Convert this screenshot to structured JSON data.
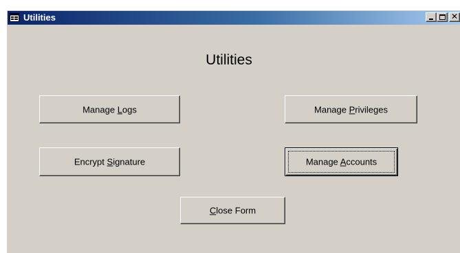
{
  "window": {
    "title": "Utilities",
    "icon": "form-icon",
    "controls": {
      "minimize": "minimize-icon",
      "maximize": "maximize-icon",
      "close": "close-icon"
    }
  },
  "form": {
    "heading": "Utilities",
    "buttons": {
      "manage_logs": {
        "pre": "Manage ",
        "accel": "L",
        "post": "ogs"
      },
      "manage_privileges": {
        "pre": "Manage ",
        "accel": "P",
        "post": "rivileges"
      },
      "encrypt_signature": {
        "pre": "Encrypt ",
        "accel": "S",
        "post": "ignature"
      },
      "manage_accounts": {
        "pre": "Manage ",
        "accel": "A",
        "post": "ccounts"
      },
      "close_form": {
        "pre": "",
        "accel": "C",
        "post": "lose Form"
      }
    },
    "focused_button": "Manage Accounts"
  },
  "colors": {
    "titlebar_start": "#0a246a",
    "titlebar_end": "#a6caf0",
    "face": "#d4d0c8"
  }
}
